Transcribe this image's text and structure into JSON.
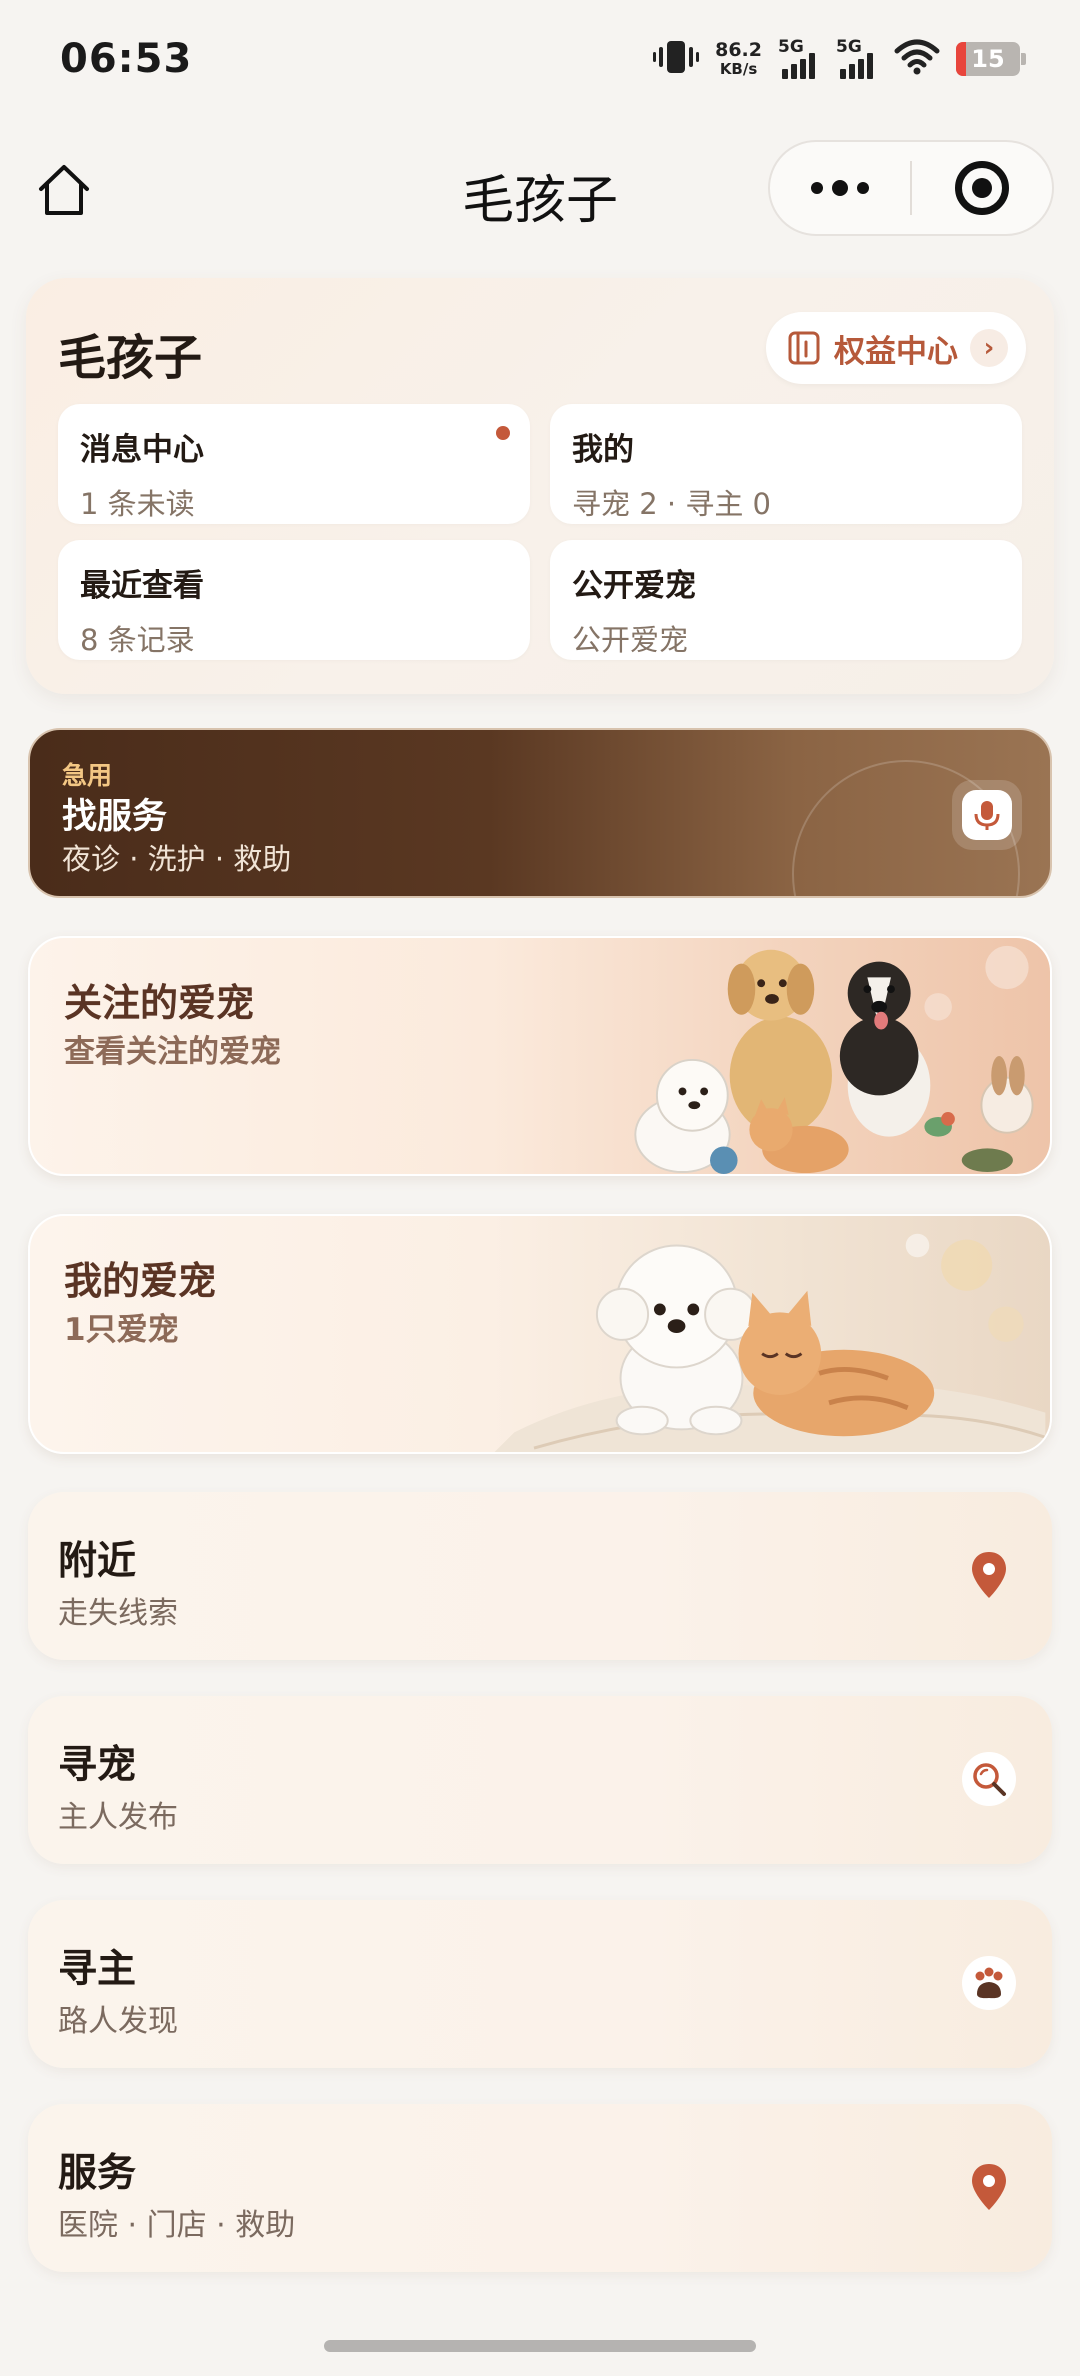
{
  "status_bar": {
    "time": "06:53",
    "net_speed_value": "86.2",
    "net_speed_unit": "KB/s",
    "signal1_label": "5G",
    "signal2_label": "5G",
    "battery_level": "15",
    "icons": [
      "vibrate-icon",
      "wifi-icon",
      "battery-icon"
    ]
  },
  "nav": {
    "title": "毛孩子",
    "home_icon": "home-icon",
    "more_icon": "more-dots-icon",
    "close_icon": "target-circle-icon"
  },
  "top_card": {
    "title": "毛孩子",
    "benefit_button": "权益中心",
    "benefit_chevron": "›",
    "tiles": [
      {
        "title": "消息中心",
        "subtitle": "1 条未读",
        "has_dot": true
      },
      {
        "title": "我的",
        "subtitle": "寻宠 2 · 寻主 0",
        "has_dot": false
      },
      {
        "title": "最近查看",
        "subtitle": "8 条记录",
        "has_dot": false
      },
      {
        "title": "公开爱宠",
        "subtitle": "公开爱宠",
        "has_dot": false
      }
    ]
  },
  "urgent_banner": {
    "tag": "急用",
    "title": "找服务",
    "subtitle": "夜诊 · 洗护 · 救助",
    "icon": "microphone-icon"
  },
  "followed_pets": {
    "title": "关注的爱宠",
    "subtitle": "查看关注的爱宠",
    "image": "pets-group-illustration"
  },
  "my_pets": {
    "title": "我的爱宠",
    "subtitle": "1只爱宠",
    "image": "dog-and-cat-illustration"
  },
  "list_cards": [
    {
      "title": "附近",
      "subtitle": "走失线索",
      "icon": "location-pin-icon"
    },
    {
      "title": "寻宠",
      "subtitle": "主人发布",
      "icon": "search-magnifier-icon"
    },
    {
      "title": "寻主",
      "subtitle": "路人发现",
      "icon": "paw-icon"
    },
    {
      "title": "服务",
      "subtitle": "医院 · 门店 · 救助",
      "icon": "location-pin-icon"
    }
  ],
  "colors": {
    "accent": "#c4593a",
    "banner_dark": "#4a2c1a",
    "text_primary": "#231a14",
    "text_secondary": "#7b6a5f"
  }
}
